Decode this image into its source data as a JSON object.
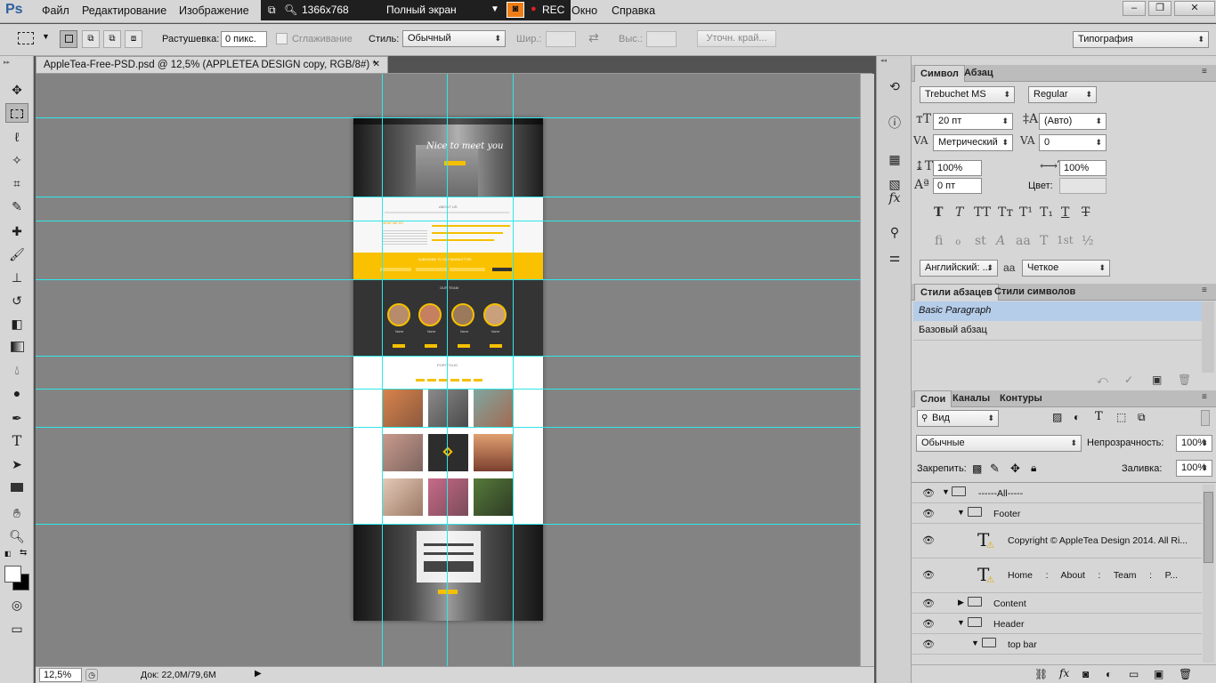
{
  "menubar": {
    "logo": "Ps",
    "items": [
      "Файл",
      "Редактирование",
      "Изображение",
      "Окно",
      "Справка"
    ],
    "recorder": {
      "resolution": "1366x768",
      "mode": "Полный экран",
      "rec": "REC"
    },
    "window_buttons": [
      "–",
      "❐",
      "✕"
    ]
  },
  "options": {
    "feather_label": "Растушевка:",
    "feather_value": "0 пикс.",
    "antialias_label": "Сглаживание",
    "style_label": "Стиль:",
    "style_value": "Обычный",
    "width_label": "Шир.:",
    "height_label": "Выс.:",
    "refine_edge": "Уточн. край...",
    "workspace": "Типография"
  },
  "document": {
    "tab_title": "AppleTea-Free-PSD.psd @ 12,5% (APPLETEA DESIGN copy, RGB/8#) *",
    "tab_close": "✕",
    "zoom": "12,5%",
    "doc_size": "Док: 22,0M/79,6M"
  },
  "artwork": {
    "hero_text": "Nice to meet you",
    "about_title": "ABOUT US",
    "about_subtitle": "WHAT WE DO",
    "newsletter_title": "SUBSCRIBE TO OUR NEWSLETTER",
    "team_title": "OUR TEAM",
    "team_names": [
      "Name",
      "Name",
      "Name",
      "Name"
    ],
    "portfolio_title": "PORTFOLIO"
  },
  "character_panel": {
    "tabs": [
      "Символ",
      "Абзац"
    ],
    "font_family": "Trebuchet MS",
    "font_style": "Regular",
    "size": "20 пт",
    "leading": "(Авто)",
    "kerning": "Метрический",
    "tracking": "0",
    "vscale": "100%",
    "hscale": "100%",
    "baseline": "0 пт",
    "color_label": "Цвет:",
    "style_buttons": [
      "T",
      "T",
      "TT",
      "Tт",
      "T¹",
      "T₁",
      "T",
      "T"
    ],
    "opentype_buttons": [
      "fi",
      "ℴ",
      "st",
      "A",
      "aa",
      "T",
      "1st",
      "½"
    ],
    "language": "Английский: ...",
    "aa_label": "aa",
    "antialias": "Четкое"
  },
  "styles_panel": {
    "tabs": [
      "Стили абзацев",
      "Стили символов"
    ],
    "items": [
      "Basic Paragraph",
      "Базовый абзац"
    ]
  },
  "layers_panel": {
    "tabs": [
      "Слои",
      "Каналы",
      "Контуры"
    ],
    "filter": "Вид",
    "blend_mode": "Обычные",
    "opacity_label": "Непрозрачность:",
    "opacity": "100%",
    "lock_label": "Закрепить:",
    "fill_label": "Заливка:",
    "fill": "100%",
    "layers": [
      {
        "name": "------All-----",
        "kind": "group",
        "indent": 0,
        "open": true
      },
      {
        "name": "Footer",
        "kind": "group",
        "indent": 1,
        "open": true
      },
      {
        "name": "Copyright © AppleTea Design 2014. All Ri...",
        "kind": "text",
        "indent": 2
      },
      {
        "name": "Home     :     About     :     Team     :     P...",
        "kind": "text",
        "indent": 2
      },
      {
        "name": "Content",
        "kind": "group",
        "indent": 1,
        "open": false
      },
      {
        "name": "Header",
        "kind": "group",
        "indent": 1,
        "open": true
      },
      {
        "name": "top bar",
        "kind": "group",
        "indent": 2,
        "open": true
      }
    ]
  },
  "colors": {
    "guide": "#31e6e6",
    "accent_yellow": "#f5c000",
    "canvas": "#838383"
  }
}
